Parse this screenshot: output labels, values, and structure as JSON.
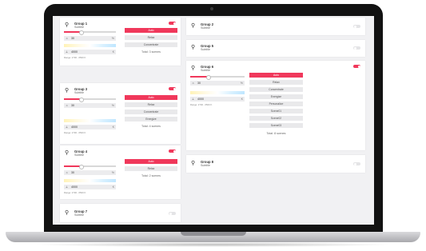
{
  "groups": {
    "g1": {
      "name": "Group 1",
      "subtitle": "Subtitle",
      "temp": "30",
      "temp_unit": "%",
      "kelvin": "4000",
      "kelvin_unit": "K",
      "range": "Range: 2700 - 6500 K",
      "brightness": 0.33,
      "scenes": [
        "Auto",
        "Relax",
        "Concentrate"
      ],
      "total": "Total: 3 scenes"
    },
    "g2": {
      "name": "Group 2",
      "subtitle": "Subtitle"
    },
    "g3": {
      "name": "Group 3",
      "subtitle": "Subtitle",
      "temp": "30",
      "temp_unit": "%",
      "kelvin": "4000",
      "kelvin_unit": "K",
      "range": "Range: 2700 - 6500 K",
      "brightness": 0.33,
      "scenes": [
        "Auto",
        "Relax",
        "Concentrate",
        "Energize"
      ],
      "total": "Total: 4 scenes"
    },
    "g4": {
      "name": "Group 4",
      "subtitle": "Subtitle",
      "temp": "30",
      "temp_unit": "%",
      "kelvin": "4000",
      "kelvin_unit": "K",
      "range": "Range: 2700 - 6500 K",
      "brightness": 0.33,
      "scenes": [
        "Auto",
        "Relax"
      ],
      "total": "Total: 2 scenes"
    },
    "g5": {
      "name": "Group 5",
      "subtitle": "Subtitle"
    },
    "g6": {
      "name": "Group 6",
      "subtitle": "Subtitle",
      "temp": "30",
      "temp_unit": "%",
      "kelvin": "4000",
      "kelvin_unit": "K",
      "range": "Range: 2700 - 6500 K",
      "brightness": 0.33,
      "scenes": [
        "Auto",
        "Relax",
        "Concentrate",
        "Energize",
        "Personalize",
        "Scene01",
        "Scene02",
        "Scene03"
      ],
      "total": "Total: 8 scenes"
    },
    "g7": {
      "name": "Group 7",
      "subtitle": "Subtitle"
    },
    "g8": {
      "name": "Group 8",
      "subtitle": "Subtitle"
    }
  },
  "icons": {
    "group": "lamp-icon",
    "temp": "sun-icon",
    "kelvin": "thermometer-icon"
  },
  "colors": {
    "accent": "#f0385b",
    "button": "#e9e9eb",
    "toggle_off": "#e4e4e6"
  }
}
